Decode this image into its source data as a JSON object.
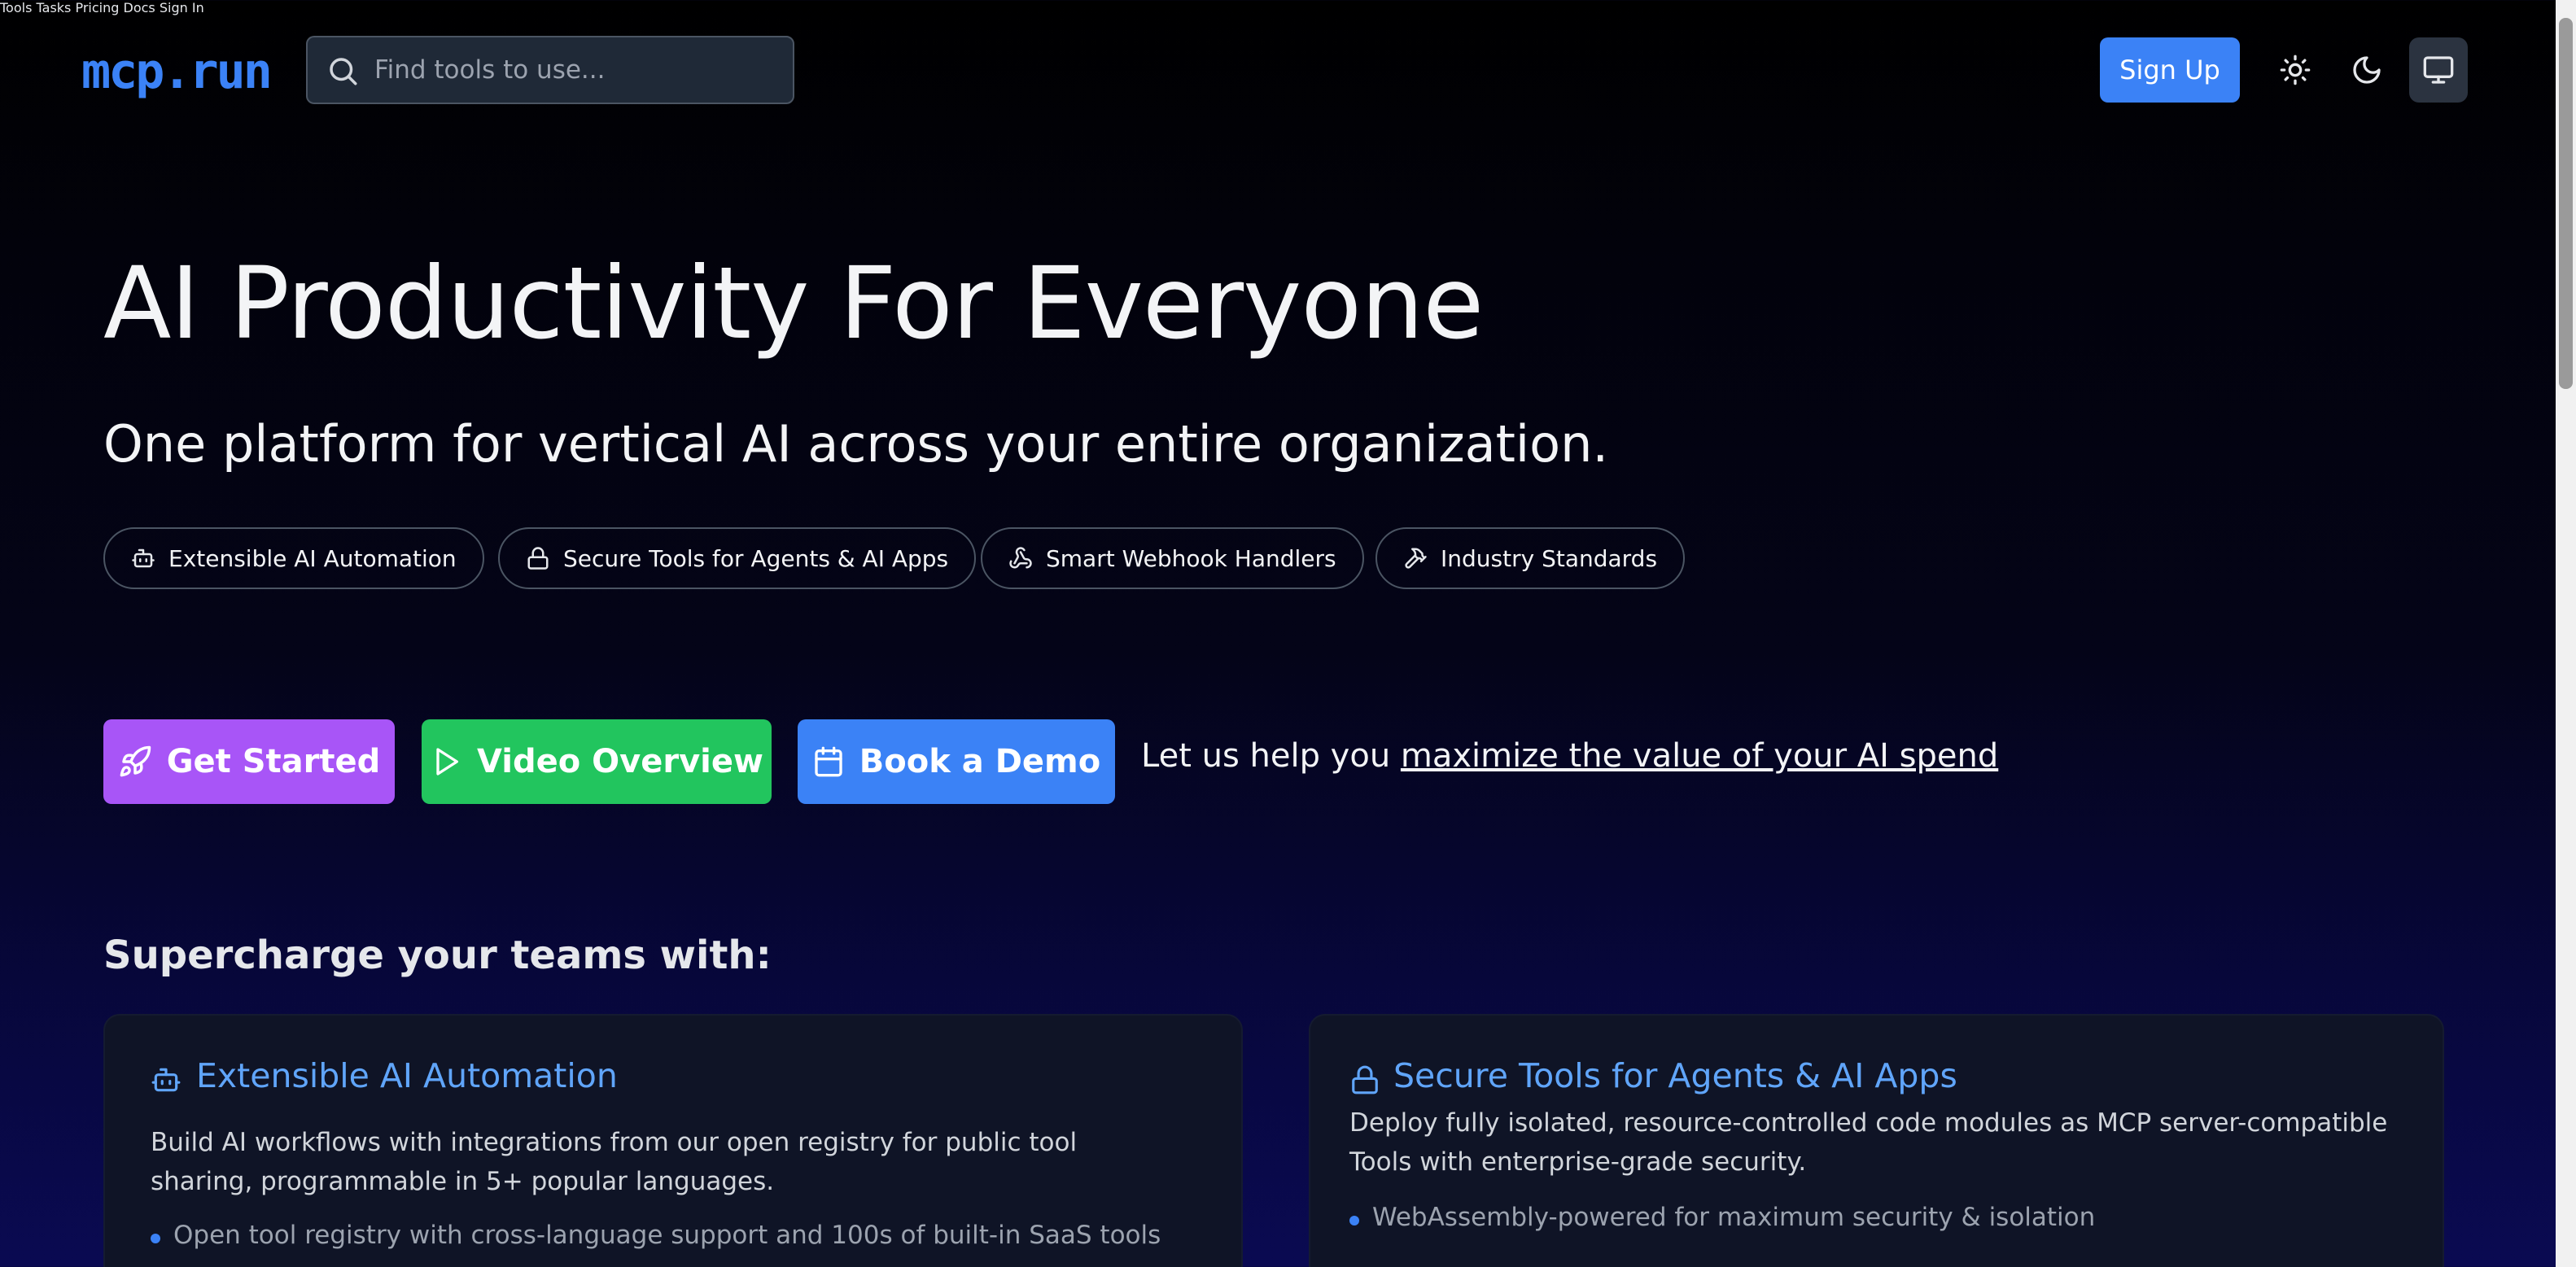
{
  "header": {
    "logo": "mcp.run",
    "search_placeholder": "Find tools to use...",
    "nav": [
      "Tools",
      "Tasks",
      "Pricing",
      "Docs",
      "Sign In"
    ],
    "signup_label": "Sign Up",
    "theme_options": [
      "sun-icon",
      "moon-icon",
      "monitor-icon"
    ],
    "active_theme": "monitor-icon"
  },
  "hero": {
    "title": "AI Productivity For Everyone",
    "subtitle": "One platform for vertical AI across your entire organization.",
    "pills": [
      {
        "label": "Extensible AI Automation",
        "icon": "bot-icon"
      },
      {
        "label": "Secure Tools for Agents & AI Apps",
        "icon": "lock-icon"
      },
      {
        "label": "Smart Webhook Handlers",
        "icon": "webhook-icon"
      },
      {
        "label": "Industry Standards",
        "icon": "hammer-icon"
      }
    ],
    "cta": {
      "get_started": "Get Started",
      "video_overview": "Video Overview",
      "book_demo": "Book a Demo"
    },
    "help_prefix": "Let us help you ",
    "help_link": "maximize the value of your AI spend"
  },
  "colors": {
    "accent": "#3b82f6",
    "get_started": "#a855f7",
    "video_overview": "#22c55e",
    "book_demo": "#3b82f6",
    "card_title": "#60a5fa"
  },
  "features": {
    "section_title": "Supercharge your teams with:",
    "cards": [
      {
        "title": "Extensible AI Automation",
        "icon": "bot-icon",
        "description": "Build AI workflows with integrations from our open registry for public tool sharing, programmable in 5+ popular languages.",
        "bullets": [
          "Open tool registry with cross-language support and 100s of built-in SaaS tools"
        ]
      },
      {
        "title": "Secure Tools for Agents & AI Apps",
        "icon": "lock-icon",
        "description": "Deploy fully isolated, resource-controlled code modules as MCP server-compatible Tools with enterprise-grade security.",
        "bullets": [
          "WebAssembly-powered for maximum security & isolation"
        ]
      }
    ]
  }
}
